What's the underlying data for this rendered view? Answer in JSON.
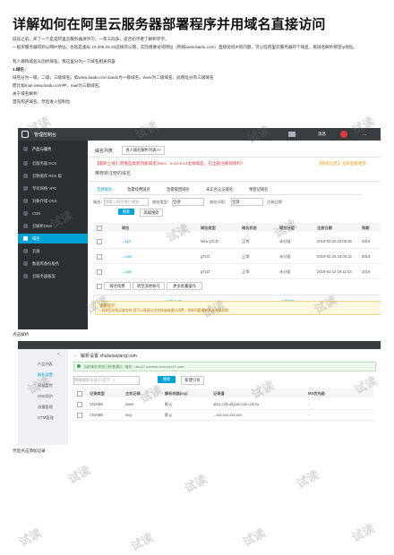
{
  "title": "详解如何在阿里云服务器部署程序并用域名直接访问",
  "paragraphs": {
    "p1": "前段之前，买了一个是是阿里云服务器承学习，一年三四多，适合初学者了解和学学。",
    "p2": "一般买服务器得到公网IP地址，也就是类似 10.205.25.33这样的公网，实际想要访问网址（例如www.baidu.com）直接访问IP的问题，可以在阿里云服务器开个域名，再域名解析绑定ip地址。",
    "p3": "有人要购域名么因析域名，我这里分为一下域名相关内容",
    "p4": "1.域名：",
    "p5": "域名分为一级，二级，三级域名，如www.baidu.com,baidu为一级域名，www为二级域名，此网址分有三级域名",
    "p6": "而比如mail.www.baidu.com中，mail为三级域名。",
    "p7": "关于域名解析：",
    "p8": "首先购买域名，然后进入控制台",
    "caption1": "点击解析",
    "caption2": "然后点击添加记录"
  },
  "watermark": "试读",
  "console1": {
    "topbar": {
      "logo": "管理控制台",
      "msg": "消息",
      "dots": "..."
    },
    "sidebar": {
      "header": "产品与服务",
      "items": [
        {
          "label": "云服务器 ECS"
        },
        {
          "label": "云数据库 RDS 版"
        },
        {
          "label": "专有网络 VPC"
        },
        {
          "label": "对象存储 OSS"
        },
        {
          "label": "CDN"
        },
        {
          "label": "云解析DNS"
        },
        {
          "label": "域名"
        },
        {
          "label": "云盾"
        },
        {
          "label": "数据库备份服务"
        },
        {
          "label": "云服务器备案"
        }
      ]
    },
    "main": {
      "page_title": "域名列表",
      "dropdown": "进入域名解析列表>>",
      "promo": "【最新上线】新增品类新功能域名,beer、9.12-9.14全线域名，已全部注册商资料！",
      "promo_right": "【购买信息】立即查看更多",
      "recommend": "推荐转注册的域名",
      "tabs": [
        "全部域名",
        "急需续费域名",
        "急需赎回域名",
        "未实名认证域名",
        "预登记域名"
      ],
      "filters": {
        "domain_label": "域名：",
        "domain_placeholder": "请输入域名进行搜索",
        "type_label": "域名类型：",
        "type_value": "全部",
        "group_label": "域名分组：",
        "group_value": "全部",
        "reg_label": "注册日期"
      },
      "search_btn": "搜索",
      "advanced_btn": "高级搜索",
      "columns": [
        "域名",
        "域名类型",
        "域名状态",
        "域名分组",
        "注册日期",
        "到期"
      ],
      "rows": [
        {
          "domain": "...xyz",
          "type": "New gTLD",
          "status": "正常",
          "group": "未分组",
          "date": "2019-02-23 18:05:35",
          "exp": "2019"
        },
        {
          "domain": "...com",
          "type": "gTLD",
          "status": "正常",
          "group": "未分组",
          "date": "2019-02-23 18:05:32",
          "exp": "2019"
        },
        {
          "domain": "...com",
          "type": "gTLD",
          "status": "正常",
          "group": "未分组",
          "date": "2019-02-12 19:11:43",
          "exp": "2019"
        }
      ],
      "bottom_btns": [
        "域名续费",
        "转至其他账号",
        "更多批量操作"
      ],
      "link_left": "域名注册",
      "link_right": "域名转入",
      "notice_title": "温馨提示：",
      "notice_text": "• 如果您在购买域名时,您可以直接点击完成或者通过续费，如有问题请联系域名服务商"
    }
  },
  "console2": {
    "side_items": [
      {
        "label": "产品列表"
      },
      {
        "label": "解析设置"
      },
      {
        "label": "网站监控"
      },
      {
        "label": "DNS防护"
      },
      {
        "label": "流量管理"
      },
      {
        "label": "GTM管理"
      }
    ],
    "back": "<",
    "title": "解析设置 zhuliutaojiang.com",
    "alert": "当前域名状态已检查通过, 域名：zhu17.com/ns.com zhu17.com",
    "search_placeholder": "精确搜索记录(只读下...)",
    "search_btn": "搜索",
    "add_btn": "新建引导",
    "columns": [
      "记录类型",
      "主机记录",
      "解析线路(isp)",
      "记录值",
      "MX优先级"
    ],
    "rows": [
      {
        "type": "CNAME",
        "host": "www",
        "line": "默认",
        "value": "abc1.cdn.aliyun.com.cdn.tw",
        "mx": "-"
      },
      {
        "type": "CNAME",
        "host": "img",
        "line": "默认",
        "value": "...xxx.xxx.xxx.xxx",
        "mx": "-"
      }
    ]
  },
  "colors": {
    "accent": "#00a1d6",
    "promo_red": "#e4393c",
    "sidebar": "#2c3035",
    "topbar": "#373d41"
  }
}
